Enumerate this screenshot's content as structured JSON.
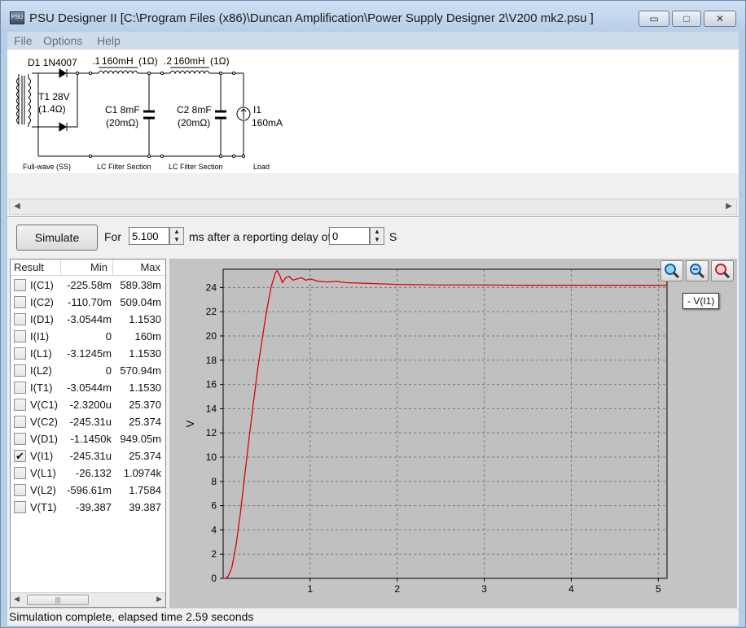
{
  "window": {
    "title": "PSU Designer II  [C:\\Program Files (x86)\\Duncan Amplification\\Power Supply Designer 2\\V200 mk2.psu ]",
    "app_icon_text": "PSU",
    "minimize_glyph": "▭",
    "maximize_glyph": "□",
    "close_glyph": "✕"
  },
  "menu": {
    "items": [
      "File",
      "Options",
      "Help"
    ]
  },
  "schematic": {
    "d1": "D1 1N4007",
    "t1_a": "T1 28V",
    "t1_b": "(1.4Ω)",
    "n1": ".1",
    "l1_val": "160mH",
    "l1_res": "(1Ω)",
    "n2": ".2",
    "l2_val": "160mH",
    "l2_res": "(1Ω)",
    "c1_a": "C1 8mF",
    "c1_b": "(20mΩ)",
    "c2_a": "C2 8mF",
    "c2_b": "(20mΩ)",
    "i1_a": "I1",
    "i1_b": "160mA",
    "sec1": "Full-wave (SS)",
    "sec2": "LC Filter Section",
    "sec3": "LC Filter Section",
    "sec4": "Load"
  },
  "sim": {
    "simulate_label": "Simulate",
    "for_label": "For",
    "duration": "5.100",
    "ms_label": "ms  after a reporting delay of",
    "delay": "0",
    "s_label": "S"
  },
  "results": {
    "headers": {
      "result": "Result",
      "min": "Min",
      "max": "Max"
    },
    "scroll_thumb": "|||",
    "rows": [
      {
        "name": "I(C1)",
        "min": "-225.58m",
        "max": "589.38m",
        "checked": false
      },
      {
        "name": "I(C2)",
        "min": "-110.70m",
        "max": "509.04m",
        "checked": false
      },
      {
        "name": "I(D1)",
        "min": "-3.0544m",
        "max": "1.1530",
        "checked": false
      },
      {
        "name": "I(I1)",
        "min": "0",
        "max": "160m",
        "checked": false
      },
      {
        "name": "I(L1)",
        "min": "-3.1245m",
        "max": "1.1530",
        "checked": false
      },
      {
        "name": "I(L2)",
        "min": "0",
        "max": "570.94m",
        "checked": false
      },
      {
        "name": "I(T1)",
        "min": "-3.0544m",
        "max": "1.1530",
        "checked": false
      },
      {
        "name": "V(C1)",
        "min": "-2.3200u",
        "max": "25.370",
        "checked": false
      },
      {
        "name": "V(C2)",
        "min": "-245.31u",
        "max": "25.374",
        "checked": false
      },
      {
        "name": "V(D1)",
        "min": "-1.1450k",
        "max": "949.05m",
        "checked": false
      },
      {
        "name": "V(I1)",
        "min": "-245.31u",
        "max": "25.374",
        "checked": true
      },
      {
        "name": "V(L1)",
        "min": "-26.132",
        "max": "1.0974k",
        "checked": false
      },
      {
        "name": "V(L2)",
        "min": "-596.61m",
        "max": "1.7584",
        "checked": false
      },
      {
        "name": "V(T1)",
        "min": "-39.387",
        "max": "39.387",
        "checked": false
      }
    ]
  },
  "legend": {
    "label": "- V(I1)"
  },
  "status": {
    "text": "Simulation complete, elapsed time 2.59 seconds"
  },
  "chart_data": {
    "type": "line",
    "title": "",
    "xlabel": "",
    "ylabel": "V",
    "xlim": [
      0,
      5.1
    ],
    "ylim": [
      0,
      25.5
    ],
    "x_ticks": [
      1,
      2,
      3,
      4,
      5
    ],
    "y_ticks": [
      0,
      2,
      4,
      6,
      8,
      10,
      12,
      14,
      16,
      18,
      20,
      22,
      24
    ],
    "grid": true,
    "legend_position": "top-right",
    "series": [
      {
        "name": "V(I1)",
        "color": "#e00000",
        "x": [
          0.0,
          0.03,
          0.06,
          0.1,
          0.15,
          0.2,
          0.25,
          0.3,
          0.35,
          0.4,
          0.45,
          0.5,
          0.55,
          0.6,
          0.62,
          0.65,
          0.68,
          0.72,
          0.76,
          0.8,
          0.85,
          0.9,
          0.95,
          1.0,
          1.1,
          1.2,
          1.3,
          1.4,
          1.6,
          1.8,
          2.0,
          2.5,
          3.0,
          3.5,
          4.0,
          4.5,
          5.1
        ],
        "y": [
          0.0,
          0.0,
          0.2,
          0.9,
          2.8,
          5.5,
          8.6,
          11.7,
          14.6,
          17.4,
          19.8,
          22.1,
          24.0,
          25.2,
          25.37,
          25.0,
          24.4,
          24.8,
          24.9,
          24.6,
          24.7,
          24.8,
          24.6,
          24.7,
          24.5,
          24.45,
          24.5,
          24.4,
          24.35,
          24.3,
          24.25,
          24.2,
          24.2,
          24.18,
          24.18,
          24.17,
          24.17
        ]
      }
    ]
  }
}
